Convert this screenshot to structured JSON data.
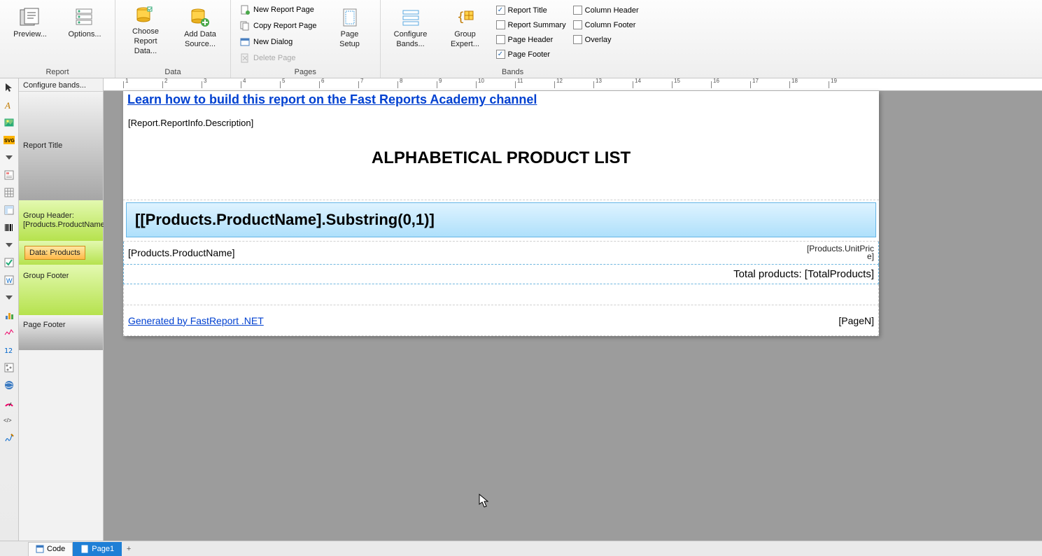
{
  "ribbon": {
    "groups": {
      "report": {
        "label": "Report",
        "preview": "Preview...",
        "options": "Options..."
      },
      "data": {
        "label": "Data",
        "choose": "Choose Report\nData...",
        "add": "Add Data\nSource..."
      },
      "pages": {
        "label": "Pages",
        "new_report_page": "New Report Page",
        "copy_report_page": "Copy Report Page",
        "new_dialog": "New Dialog",
        "delete_page": "Delete Page",
        "page_setup": "Page\nSetup"
      },
      "bands": {
        "label": "Bands",
        "configure": "Configure\nBands...",
        "group_expert": "Group\nExpert...",
        "checks": [
          {
            "label": "Report Title",
            "checked": true
          },
          {
            "label": "Report Summary",
            "checked": false
          },
          {
            "label": "Page Header",
            "checked": false
          },
          {
            "label": "Page Footer",
            "checked": true
          }
        ],
        "checks2": [
          {
            "label": "Column Header",
            "checked": false
          },
          {
            "label": "Column Footer",
            "checked": false
          },
          {
            "label": "Overlay",
            "checked": false
          }
        ]
      }
    }
  },
  "bands_panel": {
    "configure": "Configure bands...",
    "rows": {
      "report_title": "Report Title",
      "group_header": "Group Header:\n[Products.ProductName",
      "data_band": "Data: Products",
      "group_footer": "Group Footer",
      "page_footer": "Page Footer"
    }
  },
  "designer": {
    "ruler_ticks": [
      "1",
      "2",
      "3",
      "4",
      "5",
      "6",
      "7",
      "8",
      "9",
      "10",
      "11",
      "12",
      "13",
      "14",
      "15",
      "16",
      "17",
      "18",
      "19"
    ],
    "title_band": {
      "link": "Learn how to build this report on the Fast Reports Academy channel",
      "description_expr": "[Report.ReportInfo.Description]",
      "heading": "ALPHABETICAL PRODUCT LIST"
    },
    "group_header": {
      "expr": "[[Products.ProductName].Substring(0,1)]"
    },
    "data_band": {
      "product_expr": "[Products.ProductName]",
      "price_expr": "[Products.UnitPric\ne]"
    },
    "group_footer": {
      "total_expr": "Total products: [TotalProducts]"
    },
    "page_footer": {
      "generated": "Generated by FastReport .NET",
      "page_n": "[PageN]"
    }
  },
  "tabs": {
    "code": "Code",
    "page1": "Page1"
  }
}
